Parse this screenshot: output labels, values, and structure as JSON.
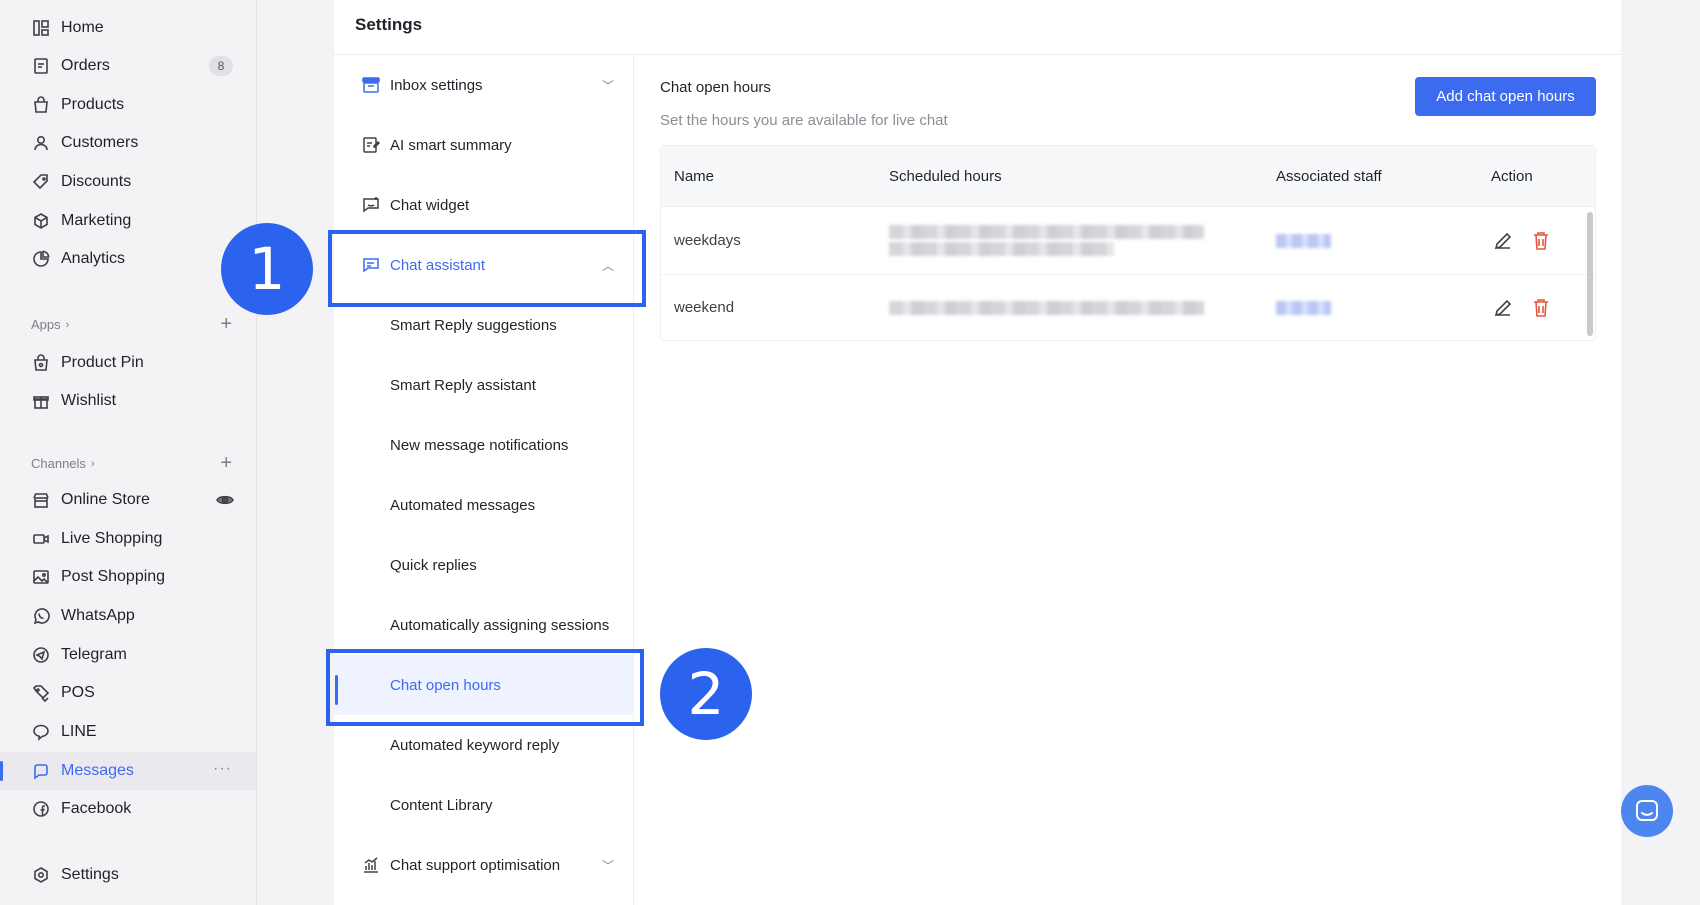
{
  "sidebar": {
    "items": [
      {
        "label": "Home",
        "icon": "dashboard-icon"
      },
      {
        "label": "Orders",
        "icon": "orders-icon",
        "badge": "8"
      },
      {
        "label": "Products",
        "icon": "bag-icon"
      },
      {
        "label": "Customers",
        "icon": "user-icon"
      },
      {
        "label": "Discounts",
        "icon": "tag-icon"
      },
      {
        "label": "Marketing",
        "icon": "cube-icon"
      },
      {
        "label": "Analytics",
        "icon": "pie-chart-icon"
      }
    ],
    "apps_label": "Apps",
    "apps": [
      {
        "label": "Product Pin",
        "icon": "pin-bag-icon"
      },
      {
        "label": "Wishlist",
        "icon": "gift-icon"
      }
    ],
    "channels_label": "Channels",
    "channels": [
      {
        "label": "Online Store",
        "icon": "store-icon"
      },
      {
        "label": "Live Shopping",
        "icon": "video-icon"
      },
      {
        "label": "Post Shopping",
        "icon": "image-icon"
      },
      {
        "label": "WhatsApp",
        "icon": "whatsapp-icon"
      },
      {
        "label": "Telegram",
        "icon": "telegram-icon"
      },
      {
        "label": "POS",
        "icon": "pos-tag-icon"
      },
      {
        "label": "LINE",
        "icon": "line-icon"
      },
      {
        "label": "Messages",
        "icon": "messages-icon",
        "active": true
      },
      {
        "label": "Facebook",
        "icon": "facebook-icon"
      }
    ],
    "settings_label": "Settings"
  },
  "panel": {
    "title": "Settings",
    "submenu": [
      {
        "label": "Inbox settings",
        "icon": "inbox-icon"
      },
      {
        "label": "AI smart summary",
        "icon": "ai-summary-icon"
      },
      {
        "label": "Chat widget",
        "icon": "chat-widget-icon"
      },
      {
        "label": "Chat assistant",
        "icon": "chat-assistant-icon"
      },
      {
        "label": "Smart Reply suggestions"
      },
      {
        "label": "Smart Reply assistant"
      },
      {
        "label": "New message notifications"
      },
      {
        "label": "Automated messages"
      },
      {
        "label": "Quick replies"
      },
      {
        "label": "Automatically assigning sessions"
      },
      {
        "label": "Chat open hours"
      },
      {
        "label": "Automated keyword reply"
      },
      {
        "label": "Content Library"
      },
      {
        "label": "Chat support optimisation",
        "icon": "bar-chart-icon"
      }
    ]
  },
  "content": {
    "title": "Chat open hours",
    "subtitle": "Set the hours you are available for live chat",
    "add_button": "Add chat open hours",
    "columns": [
      "Name",
      "Scheduled hours",
      "Associated staff",
      "Action"
    ],
    "rows": [
      {
        "name": "weekdays"
      },
      {
        "name": "weekend"
      }
    ]
  },
  "annotations": {
    "step1": "1",
    "step2": "2"
  },
  "colors": {
    "accent": "#3c6bf0",
    "annotation": "#2b63ef",
    "delete": "#e8553e"
  }
}
